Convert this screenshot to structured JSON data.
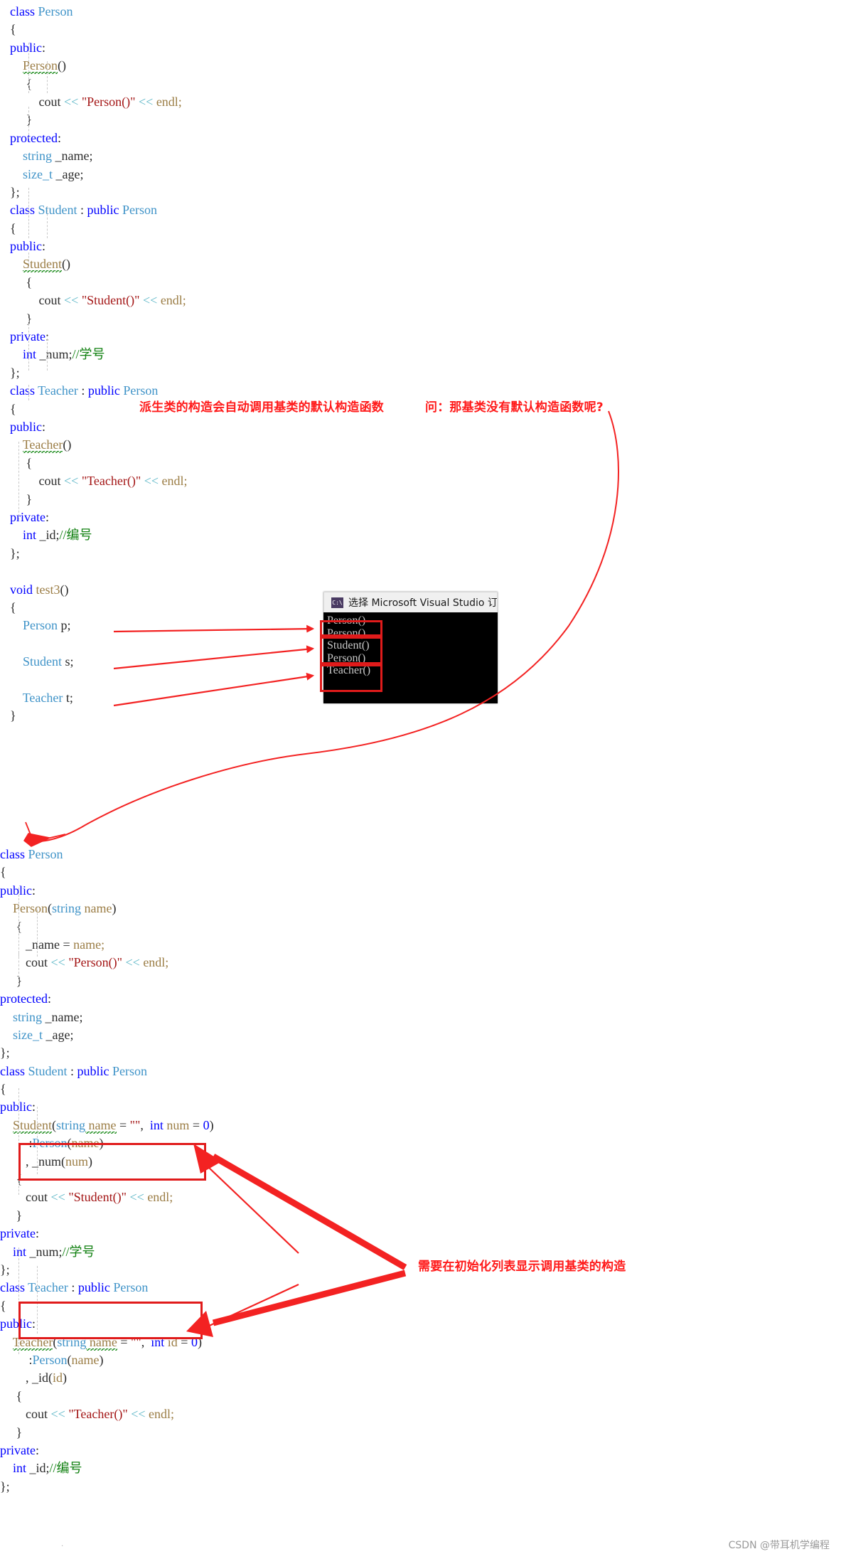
{
  "top_code": {
    "lines": [
      [
        {
          "t": "class ",
          "c": "kw"
        },
        {
          "t": "Person",
          "c": "type"
        }
      ],
      [
        {
          "t": "{",
          "c": "plain"
        }
      ],
      [
        {
          "t": "public",
          "c": "kw"
        },
        {
          "t": ":",
          "c": "plain"
        }
      ],
      [
        {
          "t": "    ",
          "c": "plain"
        },
        {
          "t": "Person",
          "c": "fn sq"
        },
        {
          "t": "()",
          "c": "plain"
        }
      ],
      [
        {
          "t": "     {",
          "c": "plain"
        }
      ],
      [
        {
          "t": "         cout ",
          "c": "plain"
        },
        {
          "t": "<<",
          "c": "op"
        },
        {
          "t": " \"Person()\"",
          "c": "str"
        },
        {
          "t": " <<",
          "c": "op"
        },
        {
          "t": " endl;",
          "c": "fn"
        }
      ],
      [
        {
          "t": "     }",
          "c": "plain"
        }
      ],
      [
        {
          "t": "protected",
          "c": "kw"
        },
        {
          "t": ":",
          "c": "plain"
        }
      ],
      [
        {
          "t": "    ",
          "c": "plain"
        },
        {
          "t": "string",
          "c": "type"
        },
        {
          "t": " _name;",
          "c": "plain"
        }
      ],
      [
        {
          "t": "    ",
          "c": "plain"
        },
        {
          "t": "size_t",
          "c": "type"
        },
        {
          "t": " _age;",
          "c": "plain"
        }
      ],
      [
        {
          "t": "};",
          "c": "plain"
        }
      ],
      [
        {
          "t": "class ",
          "c": "kw"
        },
        {
          "t": "Student",
          "c": "type"
        },
        {
          "t": " : ",
          "c": "plain"
        },
        {
          "t": "public ",
          "c": "kw"
        },
        {
          "t": "Person",
          "c": "type"
        }
      ],
      [
        {
          "t": "{",
          "c": "plain"
        }
      ],
      [
        {
          "t": "public",
          "c": "kw"
        },
        {
          "t": ":",
          "c": "plain"
        }
      ],
      [
        {
          "t": "    ",
          "c": "plain"
        },
        {
          "t": "Student",
          "c": "fn sq"
        },
        {
          "t": "()",
          "c": "plain"
        }
      ],
      [
        {
          "t": "     {",
          "c": "plain"
        }
      ],
      [
        {
          "t": "         cout ",
          "c": "plain"
        },
        {
          "t": "<<",
          "c": "op"
        },
        {
          "t": " \"Student()\"",
          "c": "str"
        },
        {
          "t": " <<",
          "c": "op"
        },
        {
          "t": " endl;",
          "c": "fn"
        }
      ],
      [
        {
          "t": "     }",
          "c": "plain"
        }
      ],
      [
        {
          "t": "private",
          "c": "kw"
        },
        {
          "t": ":",
          "c": "plain"
        }
      ],
      [
        {
          "t": "    ",
          "c": "plain"
        },
        {
          "t": "int",
          "c": "kw"
        },
        {
          "t": " _num;",
          "c": "plain"
        },
        {
          "t": "//学号",
          "c": "cmt"
        }
      ],
      [
        {
          "t": "};",
          "c": "plain"
        }
      ],
      [
        {
          "t": "class ",
          "c": "kw"
        },
        {
          "t": "Teacher",
          "c": "type"
        },
        {
          "t": " : ",
          "c": "plain"
        },
        {
          "t": "public ",
          "c": "kw"
        },
        {
          "t": "Person",
          "c": "type"
        }
      ],
      [
        {
          "t": "{",
          "c": "plain"
        }
      ],
      [
        {
          "t": "public",
          "c": "kw"
        },
        {
          "t": ":",
          "c": "plain"
        }
      ],
      [
        {
          "t": "    ",
          "c": "plain"
        },
        {
          "t": "Teacher",
          "c": "fn sq"
        },
        {
          "t": "()",
          "c": "plain"
        }
      ],
      [
        {
          "t": "     {",
          "c": "plain"
        }
      ],
      [
        {
          "t": "         cout ",
          "c": "plain"
        },
        {
          "t": "<<",
          "c": "op"
        },
        {
          "t": " \"Teacher()\"",
          "c": "str"
        },
        {
          "t": " <<",
          "c": "op"
        },
        {
          "t": " endl;",
          "c": "fn"
        }
      ],
      [
        {
          "t": "     }",
          "c": "plain"
        }
      ],
      [
        {
          "t": "private",
          "c": "kw"
        },
        {
          "t": ":",
          "c": "plain"
        }
      ],
      [
        {
          "t": "    ",
          "c": "plain"
        },
        {
          "t": "int",
          "c": "kw"
        },
        {
          "t": " _id;",
          "c": "plain"
        },
        {
          "t": "//编号",
          "c": "cmt"
        }
      ],
      [
        {
          "t": "};",
          "c": "plain"
        }
      ],
      [
        {
          "t": "",
          "c": "plain"
        }
      ],
      [
        {
          "t": "void ",
          "c": "kw"
        },
        {
          "t": "test3",
          "c": "fn"
        },
        {
          "t": "()",
          "c": "plain"
        }
      ],
      [
        {
          "t": "{",
          "c": "plain"
        }
      ],
      [
        {
          "t": "    ",
          "c": "plain"
        },
        {
          "t": "Person",
          "c": "type"
        },
        {
          "t": " p;",
          "c": "plain"
        }
      ],
      [
        {
          "t": "",
          "c": "plain"
        }
      ],
      [
        {
          "t": "    ",
          "c": "plain"
        },
        {
          "t": "Student",
          "c": "type"
        },
        {
          "t": " s;",
          "c": "plain"
        }
      ],
      [
        {
          "t": "",
          "c": "plain"
        }
      ],
      [
        {
          "t": "    ",
          "c": "plain"
        },
        {
          "t": "Teacher",
          "c": "type"
        },
        {
          "t": " t;",
          "c": "plain"
        }
      ],
      [
        {
          "t": "}",
          "c": "plain"
        }
      ]
    ]
  },
  "bottom_code": {
    "lines": [
      [
        {
          "t": "class ",
          "c": "kw"
        },
        {
          "t": "Person",
          "c": "type"
        }
      ],
      [
        {
          "t": "{",
          "c": "plain"
        }
      ],
      [
        {
          "t": "public",
          "c": "kw"
        },
        {
          "t": ":",
          "c": "plain"
        }
      ],
      [
        {
          "t": "    ",
          "c": "plain"
        },
        {
          "t": "Person",
          "c": "fn"
        },
        {
          "t": "(",
          "c": "plain"
        },
        {
          "t": "string",
          "c": "type"
        },
        {
          "t": " name",
          "c": "fn"
        },
        {
          "t": ")",
          "c": "plain"
        }
      ],
      [
        {
          "t": "     {",
          "c": "plain"
        }
      ],
      [
        {
          "t": "        _name = ",
          "c": "plain"
        },
        {
          "t": "name;",
          "c": "fn"
        }
      ],
      [
        {
          "t": "        cout ",
          "c": "plain"
        },
        {
          "t": "<<",
          "c": "op"
        },
        {
          "t": " \"Person()\"",
          "c": "str"
        },
        {
          "t": " <<",
          "c": "op"
        },
        {
          "t": " endl;",
          "c": "fn"
        }
      ],
      [
        {
          "t": "     }",
          "c": "plain"
        }
      ],
      [
        {
          "t": "protected",
          "c": "kw"
        },
        {
          "t": ":",
          "c": "plain"
        }
      ],
      [
        {
          "t": "    ",
          "c": "plain"
        },
        {
          "t": "string",
          "c": "type"
        },
        {
          "t": " _name;",
          "c": "plain"
        }
      ],
      [
        {
          "t": "    ",
          "c": "plain"
        },
        {
          "t": "size_t",
          "c": "type"
        },
        {
          "t": " _age;",
          "c": "plain"
        }
      ],
      [
        {
          "t": "};",
          "c": "plain"
        }
      ],
      [
        {
          "t": "class ",
          "c": "kw"
        },
        {
          "t": "Student",
          "c": "type"
        },
        {
          "t": " : ",
          "c": "plain"
        },
        {
          "t": "public ",
          "c": "kw"
        },
        {
          "t": "Person",
          "c": "type"
        }
      ],
      [
        {
          "t": "{",
          "c": "plain"
        }
      ],
      [
        {
          "t": "public",
          "c": "kw"
        },
        {
          "t": ":",
          "c": "plain"
        }
      ],
      [
        {
          "t": "    ",
          "c": "plain"
        },
        {
          "t": "Student",
          "c": "fn sq"
        },
        {
          "t": "(",
          "c": "plain"
        },
        {
          "t": "string",
          "c": "type"
        },
        {
          "t": " name",
          "c": "fn sq"
        },
        {
          "t": " = ",
          "c": "plain"
        },
        {
          "t": "\"\"",
          "c": "str"
        },
        {
          "t": ",  ",
          "c": "plain"
        },
        {
          "t": "int",
          "c": "kw"
        },
        {
          "t": " num",
          "c": "fn"
        },
        {
          "t": " = ",
          "c": "plain"
        },
        {
          "t": "0",
          "c": "num"
        },
        {
          "t": ")",
          "c": "plain"
        }
      ],
      [
        {
          "t": "         :",
          "c": "plain"
        },
        {
          "t": "Person",
          "c": "type"
        },
        {
          "t": "(",
          "c": "plain"
        },
        {
          "t": "name",
          "c": "fn"
        },
        {
          "t": ")",
          "c": "plain"
        }
      ],
      [
        {
          "t": "        , _num",
          "c": "plain"
        },
        {
          "t": "(",
          "c": "plain"
        },
        {
          "t": "num",
          "c": "fn"
        },
        {
          "t": ")",
          "c": "plain"
        }
      ],
      [
        {
          "t": "     {",
          "c": "plain"
        }
      ],
      [
        {
          "t": "        cout ",
          "c": "plain"
        },
        {
          "t": "<<",
          "c": "op"
        },
        {
          "t": " \"Student()\"",
          "c": "str"
        },
        {
          "t": " <<",
          "c": "op"
        },
        {
          "t": " endl;",
          "c": "fn"
        }
      ],
      [
        {
          "t": "     }",
          "c": "plain"
        }
      ],
      [
        {
          "t": "private",
          "c": "kw"
        },
        {
          "t": ":",
          "c": "plain"
        }
      ],
      [
        {
          "t": "    ",
          "c": "plain"
        },
        {
          "t": "int",
          "c": "kw"
        },
        {
          "t": " _num;",
          "c": "plain"
        },
        {
          "t": "//学号",
          "c": "cmt"
        }
      ],
      [
        {
          "t": "};",
          "c": "plain"
        }
      ],
      [
        {
          "t": "class ",
          "c": "kw"
        },
        {
          "t": "Teacher",
          "c": "type"
        },
        {
          "t": " : ",
          "c": "plain"
        },
        {
          "t": "public ",
          "c": "kw"
        },
        {
          "t": "Person",
          "c": "type"
        }
      ],
      [
        {
          "t": "{",
          "c": "plain"
        }
      ],
      [
        {
          "t": "public",
          "c": "kw"
        },
        {
          "t": ":",
          "c": "plain"
        }
      ],
      [
        {
          "t": "    ",
          "c": "plain"
        },
        {
          "t": "Teacher",
          "c": "fn sq"
        },
        {
          "t": "(",
          "c": "plain"
        },
        {
          "t": "string",
          "c": "type"
        },
        {
          "t": " name",
          "c": "fn sq"
        },
        {
          "t": " = ",
          "c": "plain"
        },
        {
          "t": "\"\"",
          "c": "str"
        },
        {
          "t": ",  ",
          "c": "plain"
        },
        {
          "t": "int",
          "c": "kw"
        },
        {
          "t": " id",
          "c": "fn"
        },
        {
          "t": " = ",
          "c": "plain"
        },
        {
          "t": "0",
          "c": "num"
        },
        {
          "t": ")",
          "c": "plain"
        }
      ],
      [
        {
          "t": "         :",
          "c": "plain"
        },
        {
          "t": "Person",
          "c": "type"
        },
        {
          "t": "(",
          "c": "plain"
        },
        {
          "t": "name",
          "c": "fn"
        },
        {
          "t": ")",
          "c": "plain"
        }
      ],
      [
        {
          "t": "        , _id",
          "c": "plain"
        },
        {
          "t": "(",
          "c": "plain"
        },
        {
          "t": "id",
          "c": "fn"
        },
        {
          "t": ")",
          "c": "plain"
        }
      ],
      [
        {
          "t": "     {",
          "c": "plain"
        }
      ],
      [
        {
          "t": "        cout ",
          "c": "plain"
        },
        {
          "t": "<<",
          "c": "op"
        },
        {
          "t": " \"Teacher()\"",
          "c": "str"
        },
        {
          "t": " <<",
          "c": "op"
        },
        {
          "t": " endl;",
          "c": "fn"
        }
      ],
      [
        {
          "t": "     }",
          "c": "plain"
        }
      ],
      [
        {
          "t": "private",
          "c": "kw"
        },
        {
          "t": ":",
          "c": "plain"
        }
      ],
      [
        {
          "t": "    ",
          "c": "plain"
        },
        {
          "t": "int",
          "c": "kw"
        },
        {
          "t": " _id;",
          "c": "plain"
        },
        {
          "t": "//编号",
          "c": "cmt"
        }
      ],
      [
        {
          "t": "};",
          "c": "plain"
        }
      ]
    ]
  },
  "annotations": {
    "note_auto_call": "派生类的构造会自动调用基类的默认构造函数",
    "note_question": "问：那基类没有默认构造函数呢?",
    "note_init_list": "需要在初始化列表显示调用基类的构造"
  },
  "console": {
    "icon_text": "C:\\",
    "title": "选择 Microsoft Visual Studio 订",
    "output_lines": [
      "Person()",
      "Person()",
      "Student()",
      "Person()",
      "Teacher()"
    ]
  },
  "footer": {
    "watermark": "CSDN @带耳机学编程",
    "page_mark": "."
  },
  "colors": {
    "keyword": "#0000ff",
    "type": "#3f93c8",
    "string": "#a31515",
    "comment": "#108010",
    "function": "#9b7d45",
    "operator": "#5fb8c8",
    "annotation_red": "#ff1a1a",
    "box_red": "#e01b1b",
    "console_bg": "#000000"
  }
}
